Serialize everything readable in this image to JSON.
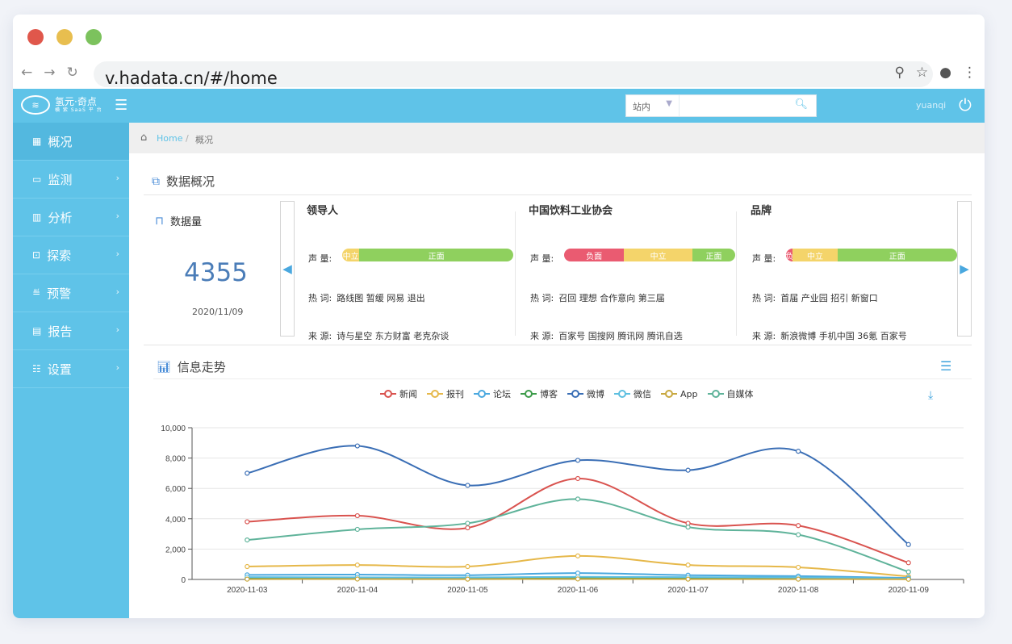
{
  "browser": {
    "url": "v.hadata.cn/#/home",
    "icons": [
      "back-icon",
      "forward-icon",
      "reload-icon",
      "zoom-icon",
      "star-icon",
      "account-icon",
      "more-icon"
    ]
  },
  "header": {
    "logo_main": "氢元·奇点",
    "logo_sub": "横 紫 SaaS 平 台",
    "search_scope": "站内",
    "search_value": "",
    "user": "yuanqi"
  },
  "sidebar": {
    "items": [
      {
        "label": "概况",
        "icon": "overview-icon"
      },
      {
        "label": "监测",
        "icon": "monitor-icon"
      },
      {
        "label": "分析",
        "icon": "analysis-icon"
      },
      {
        "label": "探索",
        "icon": "explore-icon"
      },
      {
        "label": "预警",
        "icon": "alert-icon"
      },
      {
        "label": "报告",
        "icon": "report-icon"
      },
      {
        "label": "设置",
        "icon": "settings-icon"
      }
    ]
  },
  "breadcrumb": {
    "home": "Home",
    "sep": "/",
    "current": "概况"
  },
  "overview": {
    "title": "数据概况",
    "data_label": "数据量",
    "data_count": "4355",
    "data_date": "2020/11/09"
  },
  "cards": [
    {
      "title": "领导人",
      "volume_label": "声 量:",
      "volume": [
        {
          "label": "中立",
          "pct": 10,
          "color": "#f4d46a"
        },
        {
          "label": "正面",
          "pct": 90,
          "color": "#8fd05e"
        }
      ],
      "hot_label": "热 词:",
      "hot": "路线图  暂缓  网易  退出",
      "src_label": "来 源:",
      "src": "诗与星空  东方财富  老克杂谈"
    },
    {
      "title": "中国饮料工业协会",
      "volume_label": "声 量:",
      "volume": [
        {
          "label": "负面",
          "pct": 35,
          "color": "#ea5b71"
        },
        {
          "label": "中立",
          "pct": 40,
          "color": "#f4d46a"
        },
        {
          "label": "正面",
          "pct": 25,
          "color": "#8fd05e"
        }
      ],
      "hot_label": "热 词:",
      "hot": "召回  理想  合作意向  第三届",
      "src_label": "来 源:",
      "src": "百家号  国搜网  腾讯网  腾讯自选"
    },
    {
      "title": "品牌",
      "volume_label": "声 量:",
      "volume": [
        {
          "label": "负",
          "pct": 4,
          "color": "#ea5b71"
        },
        {
          "label": "中立",
          "pct": 26,
          "color": "#f4d46a"
        },
        {
          "label": "正面",
          "pct": 70,
          "color": "#8fd05e"
        }
      ],
      "hot_label": "热 词:",
      "hot": "首届  产业园  招引  新窗口",
      "src_label": "来 源:",
      "src": "新浪微博  手机中国  36氪  百家号"
    }
  ],
  "trend": {
    "title": "信息走势"
  },
  "chart_data": {
    "type": "line",
    "x": [
      "2020-11-03",
      "2020-11-04",
      "2020-11-05",
      "2020-11-06",
      "2020-11-07",
      "2020-11-08",
      "2020-11-09"
    ],
    "ylim": [
      0,
      10000
    ],
    "yticks": [
      "0",
      "2,000",
      "4,000",
      "6,000",
      "8,000",
      "10,000"
    ],
    "legend_position": "top-center",
    "grid": true,
    "series": [
      {
        "name": "新闻",
        "color": "#d9534f",
        "values": [
          3800,
          4200,
          3400,
          6650,
          3700,
          3550,
          1100
        ]
      },
      {
        "name": "报刊",
        "color": "#e6b84a",
        "values": [
          850,
          950,
          850,
          1550,
          950,
          800,
          200
        ]
      },
      {
        "name": "论坛",
        "color": "#4aa8df",
        "values": [
          300,
          320,
          280,
          420,
          280,
          220,
          100
        ]
      },
      {
        "name": "博客",
        "color": "#3d9b4a",
        "values": [
          60,
          70,
          50,
          80,
          60,
          50,
          30
        ]
      },
      {
        "name": "微博",
        "color": "#3a6eb5",
        "values": [
          7000,
          8800,
          6200,
          7850,
          7200,
          8450,
          2300
        ]
      },
      {
        "name": "微信",
        "color": "#5dbfe0",
        "values": [
          150,
          140,
          130,
          170,
          150,
          130,
          50
        ]
      },
      {
        "name": "App",
        "color": "#c8a840",
        "values": [
          20,
          25,
          20,
          30,
          20,
          20,
          10
        ]
      },
      {
        "name": "自媒体",
        "color": "#5fb39a",
        "values": [
          2600,
          3300,
          3700,
          5300,
          3450,
          2950,
          500
        ]
      }
    ]
  }
}
